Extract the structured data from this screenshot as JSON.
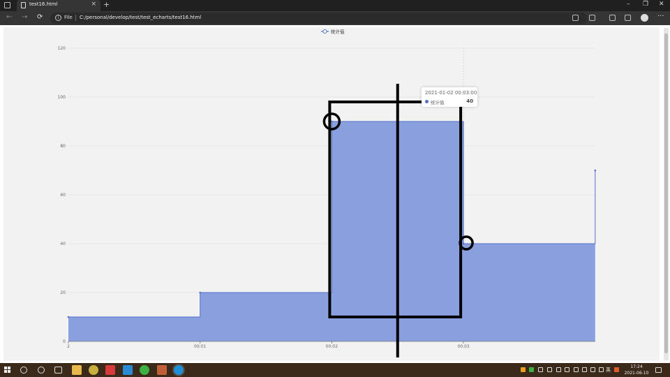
{
  "browser": {
    "tab_title": "test16.html",
    "tab_close": "×",
    "new_tab": "+",
    "scheme_label": "File",
    "url": "C:/personal/develop/test/test_echarts/test16.html",
    "window_controls": [
      "–",
      "❐",
      "✕"
    ],
    "nav": [
      "←",
      "→",
      "⟳"
    ],
    "menu": "···"
  },
  "chart_data": {
    "type": "line",
    "step": "end",
    "area": true,
    "legend": [
      "统计值"
    ],
    "legend_position": "top-center",
    "x_tick_labels": [
      "2",
      "00:01",
      "00:02",
      "00:03"
    ],
    "series": [
      {
        "name": "统计值",
        "color": "#5470c6",
        "area_color": "#8aa0de",
        "x": [
          "2021-01-02 00:00:00",
          "2021-01-02 00:01:00",
          "2021-01-02 00:02:00",
          "2021-01-02 00:03:00",
          "2021-01-02 00:04:00"
        ],
        "values": [
          10,
          20,
          90,
          40,
          70
        ]
      }
    ],
    "ylim": [
      0,
      120
    ],
    "y_ticks": [
      0,
      20,
      40,
      60,
      80,
      100,
      120
    ],
    "grid": true,
    "axis_pointer_x": "2021-01-02 00:03:00",
    "tooltip": {
      "title": "2021-01-02 00:03:00",
      "series_name": "统计值",
      "value": "40"
    }
  },
  "annotations": {
    "description": "hand-drawn black rectangle, vertical line and two circles overlaid on the chart",
    "color": "#000000"
  },
  "taskbar": {
    "time": "17:24",
    "date": "2021-06-10",
    "ime": "英"
  }
}
